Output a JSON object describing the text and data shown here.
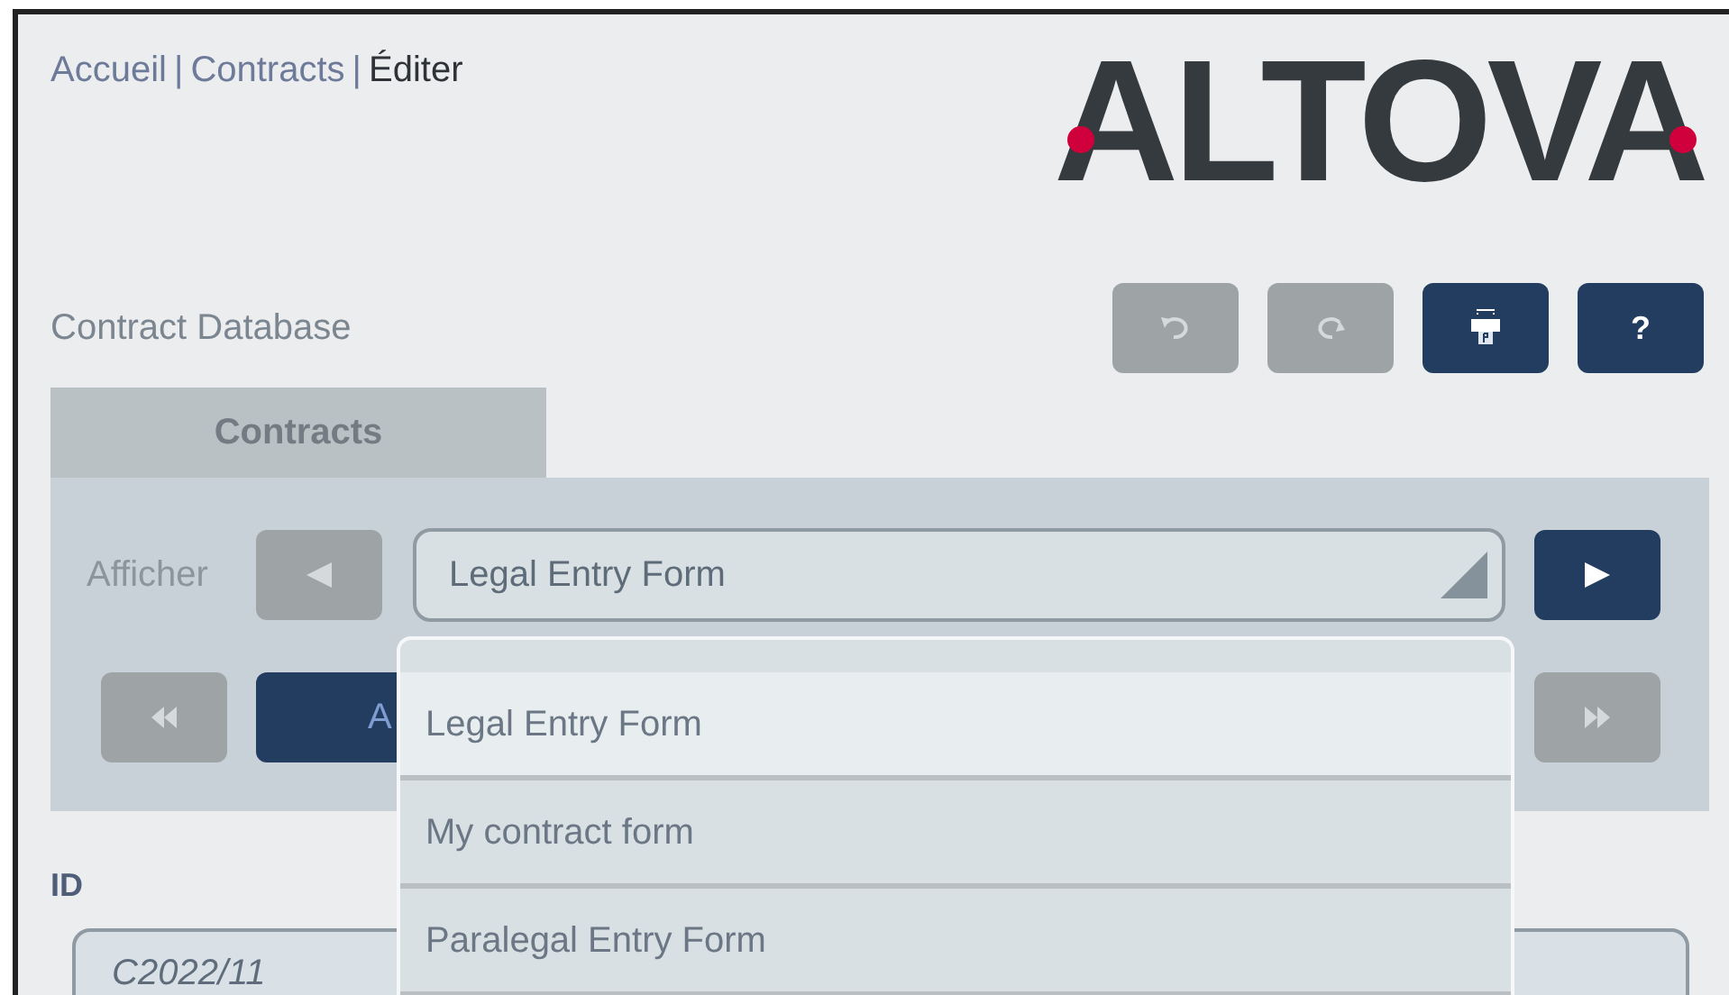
{
  "breadcrumb": [
    {
      "kind": "link",
      "text": "Accueil"
    },
    {
      "kind": "separator",
      "text": "|"
    },
    {
      "kind": "link",
      "text": "Contracts"
    },
    {
      "kind": "separator",
      "text": "|"
    },
    {
      "kind": "current",
      "text": "Éditer"
    }
  ],
  "logo": "ALTOVA",
  "app_title": "Contract Database",
  "toolbar": [
    {
      "kind": "undo",
      "disabled": true
    },
    {
      "kind": "redo",
      "disabled": true
    },
    {
      "kind": "print",
      "disabled": false
    },
    {
      "kind": "help",
      "label": "?",
      "disabled": false
    }
  ],
  "tabs": [
    {
      "label": "Contracts",
      "selected": true
    }
  ],
  "view_label": "Afficher",
  "prev_button": {
    "disabled": true
  },
  "view_select": {
    "value": "Legal Entry Form"
  },
  "next_button": {
    "disabled": false
  },
  "first_button": {
    "disabled": true
  },
  "action_button": {
    "label": "A"
  },
  "last_button": {
    "disabled": true
  },
  "dropdown_options": [
    {
      "label": "Legal Entry Form",
      "selected": true
    },
    {
      "label": "My contract form",
      "selected": false
    },
    {
      "label": "Paralegal Entry Form",
      "selected": false
    }
  ],
  "fields": [
    {
      "label": "ID",
      "value": "C2022/11"
    }
  ]
}
